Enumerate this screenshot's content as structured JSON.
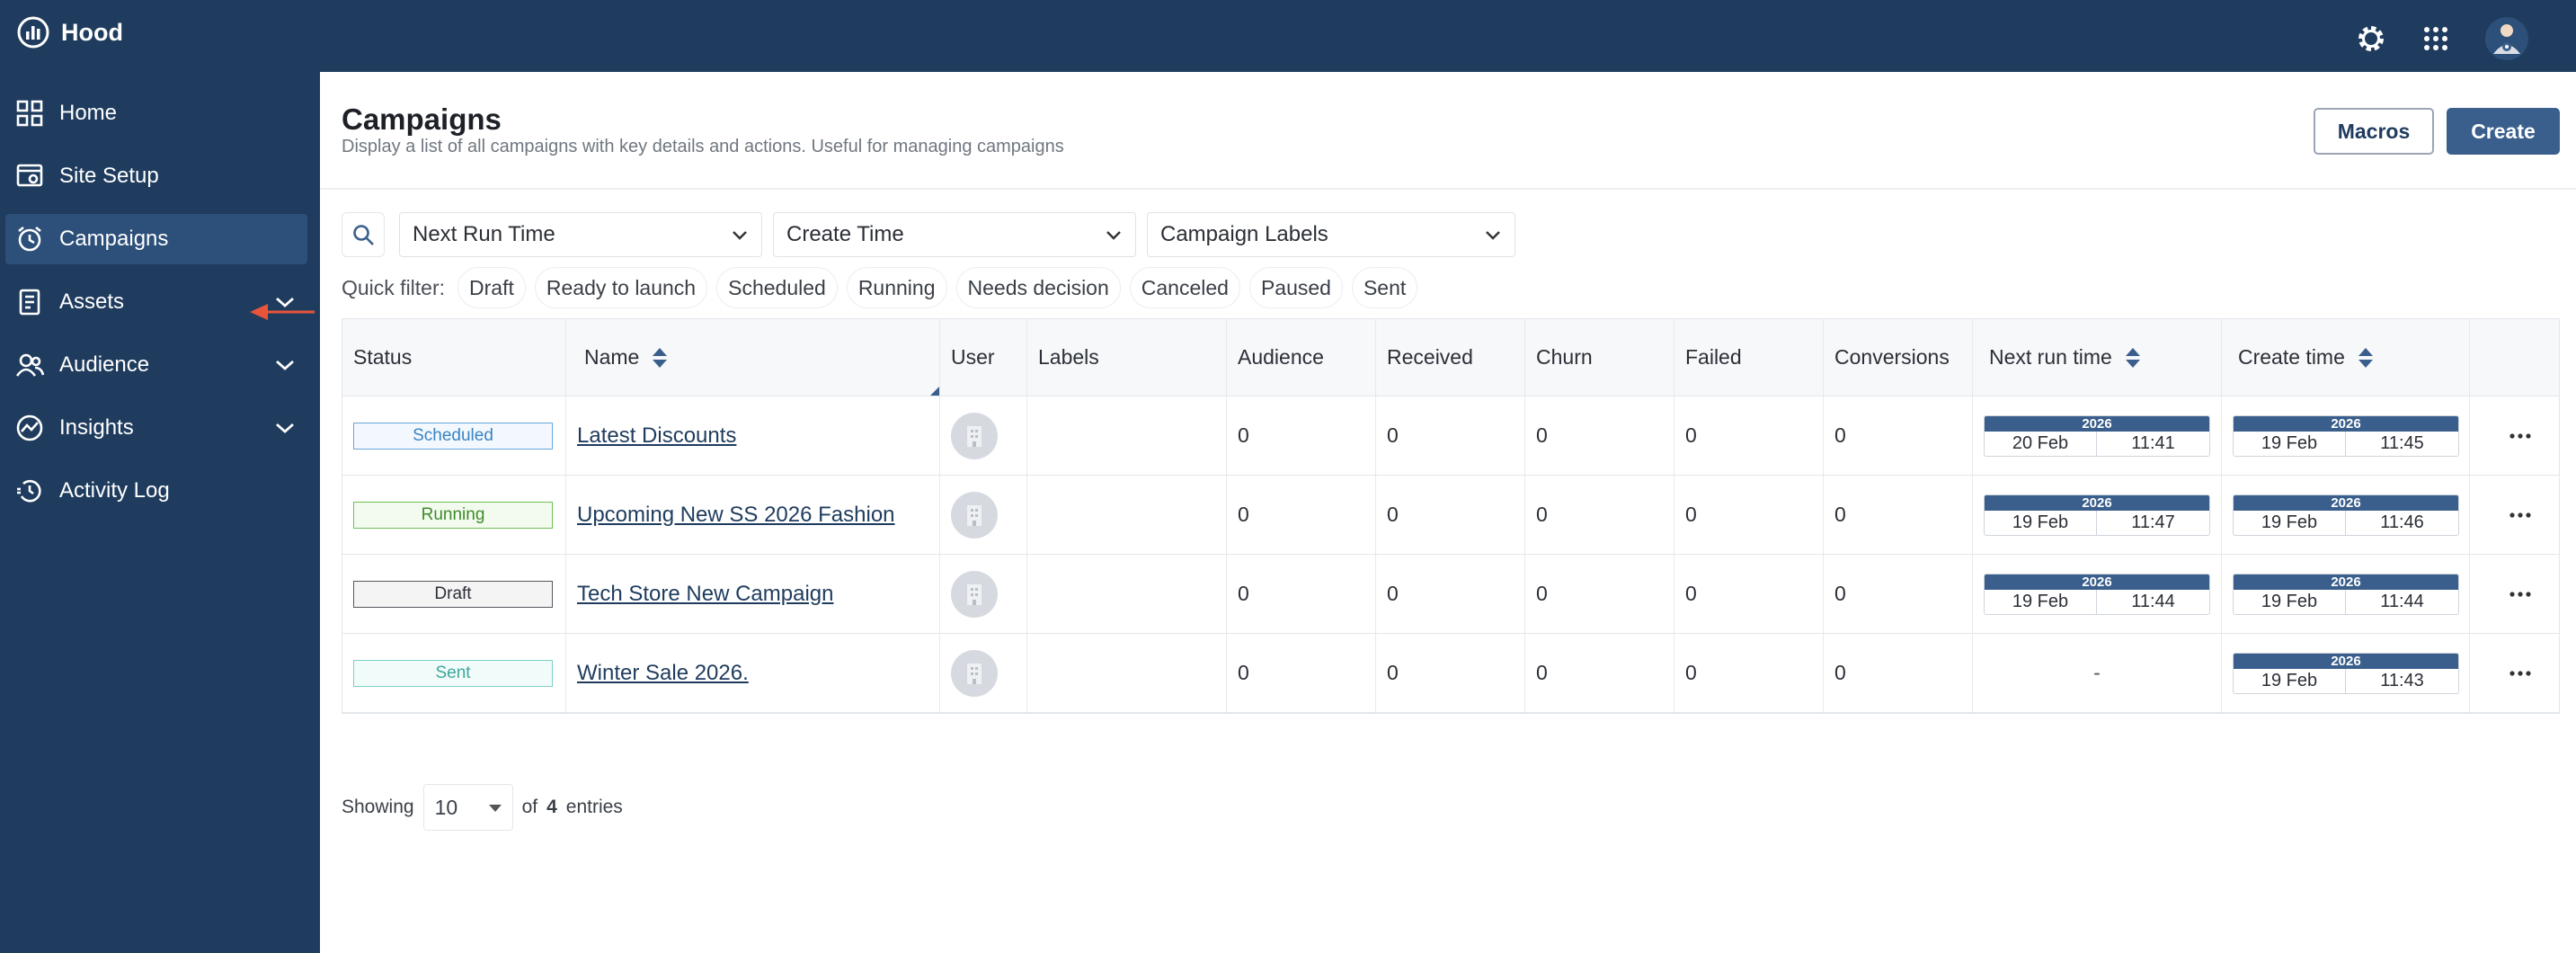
{
  "app": {
    "name": "Hood"
  },
  "sidebar": {
    "items": [
      {
        "label": "Home",
        "icon": "grid-icon",
        "active": false,
        "expandable": false
      },
      {
        "label": "Site Setup",
        "icon": "site-setup-icon",
        "active": false,
        "expandable": false
      },
      {
        "label": "Campaigns",
        "icon": "clock-icon",
        "active": true,
        "expandable": false
      },
      {
        "label": "Assets",
        "icon": "document-icon",
        "active": false,
        "expandable": true
      },
      {
        "label": "Audience",
        "icon": "users-icon",
        "active": false,
        "expandable": true
      },
      {
        "label": "Insights",
        "icon": "chart-icon",
        "active": false,
        "expandable": true
      },
      {
        "label": "Activity Log",
        "icon": "history-icon",
        "active": false,
        "expandable": false
      }
    ]
  },
  "header": {
    "title": "Campaigns",
    "subtitle": "Display a list of all campaigns with key details and actions. Useful for managing campaigns",
    "macros_label": "Macros",
    "create_label": "Create"
  },
  "filters": {
    "selects": [
      "Next Run Time",
      "Create Time",
      "Campaign Labels"
    ],
    "quick_label": "Quick filter:",
    "quick": [
      "Draft",
      "Ready to launch",
      "Scheduled",
      "Running",
      "Needs decision",
      "Canceled",
      "Paused",
      "Sent"
    ]
  },
  "table": {
    "columns": [
      "Status",
      "Name",
      "User",
      "Labels",
      "Audience",
      "Received",
      "Churn",
      "Failed",
      "Conversions",
      "Next run time",
      "Create time"
    ],
    "rows": [
      {
        "status": "Scheduled",
        "name": "Latest Discounts",
        "labels": "",
        "audience": "0",
        "received": "0",
        "churn": "0",
        "failed": "0",
        "conversions": "0",
        "next_run": {
          "year": "2026",
          "date": "20 Feb",
          "time": "11:41"
        },
        "created": {
          "year": "2026",
          "date": "19 Feb",
          "time": "11:45"
        }
      },
      {
        "status": "Running",
        "name": "Upcoming New SS 2026 Fashion",
        "labels": "",
        "audience": "0",
        "received": "0",
        "churn": "0",
        "failed": "0",
        "conversions": "0",
        "next_run": {
          "year": "2026",
          "date": "19 Feb",
          "time": "11:47"
        },
        "created": {
          "year": "2026",
          "date": "19 Feb",
          "time": "11:46"
        }
      },
      {
        "status": "Draft",
        "name": "Tech Store New Campaign",
        "labels": "",
        "audience": "0",
        "received": "0",
        "churn": "0",
        "failed": "0",
        "conversions": "0",
        "next_run": {
          "year": "2026",
          "date": "19 Feb",
          "time": "11:44"
        },
        "created": {
          "year": "2026",
          "date": "19 Feb",
          "time": "11:44"
        }
      },
      {
        "status": "Sent",
        "name": "Winter Sale 2026.",
        "labels": "",
        "audience": "0",
        "received": "0",
        "churn": "0",
        "failed": "0",
        "conversions": "0",
        "next_run": null,
        "next_run_empty": "-",
        "created": {
          "year": "2026",
          "date": "19 Feb",
          "time": "11:43"
        }
      }
    ]
  },
  "footer": {
    "showing": "Showing",
    "page_size": "10",
    "of": "of",
    "total": "4",
    "entries": "entries"
  },
  "colors": {
    "navy": "#1f3c5e",
    "accent": "#3a5f8c",
    "arrow": "#e8553a"
  }
}
